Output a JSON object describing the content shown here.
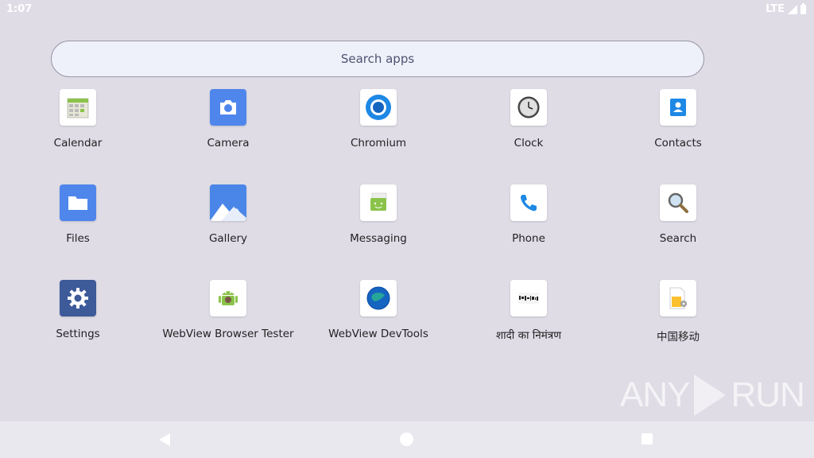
{
  "status": {
    "time": "1:07",
    "network": "LTE"
  },
  "search": {
    "placeholder": "Search apps"
  },
  "apps": [
    {
      "label": "Calendar",
      "icon": "calendar-icon"
    },
    {
      "label": "Camera",
      "icon": "camera-icon"
    },
    {
      "label": "Chromium",
      "icon": "chromium-icon"
    },
    {
      "label": "Clock",
      "icon": "clock-icon"
    },
    {
      "label": "Contacts",
      "icon": "contacts-icon"
    },
    {
      "label": "Files",
      "icon": "files-icon"
    },
    {
      "label": "Gallery",
      "icon": "gallery-icon"
    },
    {
      "label": "Messaging",
      "icon": "messaging-icon"
    },
    {
      "label": "Phone",
      "icon": "phone-icon"
    },
    {
      "label": "Search",
      "icon": "search-icon"
    },
    {
      "label": "Settings",
      "icon": "settings-icon"
    },
    {
      "label": "WebView Browser Tester",
      "icon": "webview-tester-icon"
    },
    {
      "label": "WebView DevTools",
      "icon": "webview-devtools-icon"
    },
    {
      "label": "शादी का निमंत्रण",
      "icon": "invitation-icon"
    },
    {
      "label": "中国移动",
      "icon": "china-mobile-icon"
    }
  ],
  "watermark": {
    "left": "ANY",
    "right": "RUN"
  }
}
